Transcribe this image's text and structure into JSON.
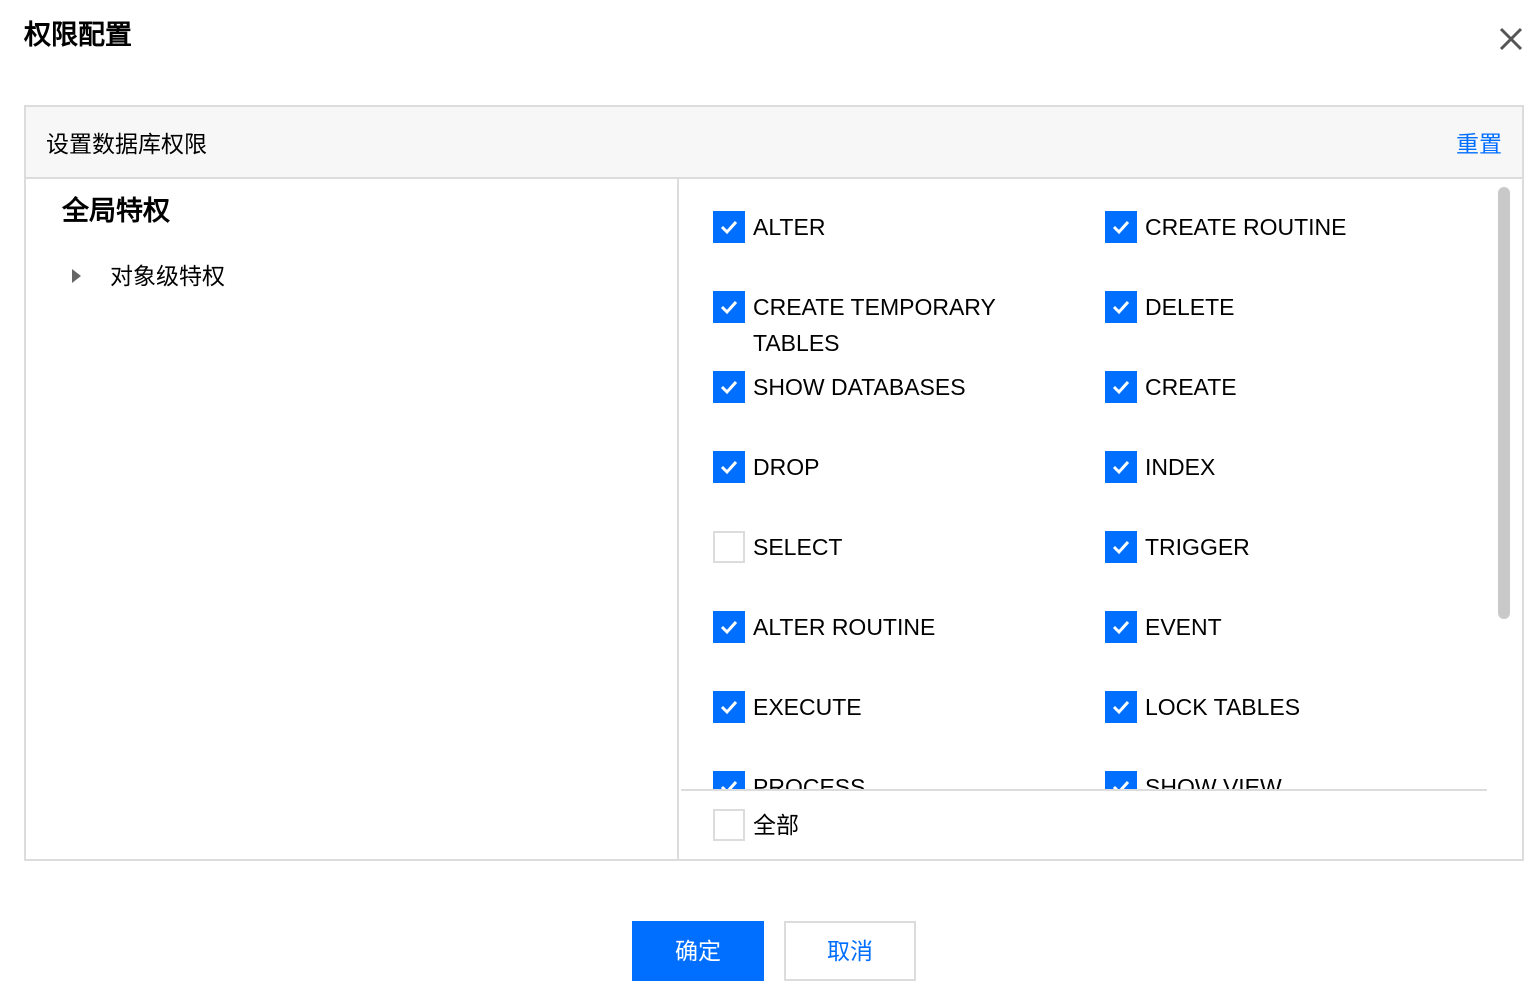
{
  "dialog": {
    "title": "权限配置",
    "close_icon": "close-icon"
  },
  "panel": {
    "title": "设置数据库权限",
    "reset_label": "重置"
  },
  "tree": {
    "root_label": "全局特权",
    "node_label": "对象级特权",
    "node_icon": "caret-right-icon"
  },
  "permissions": [
    {
      "label": "ALTER",
      "checked": true
    },
    {
      "label": "CREATE ROUTINE",
      "checked": true
    },
    {
      "label": "CREATE TEMPORARY TABLES",
      "checked": true
    },
    {
      "label": "DELETE",
      "checked": true
    },
    {
      "label": "SHOW DATABASES",
      "checked": true
    },
    {
      "label": "CREATE",
      "checked": true
    },
    {
      "label": "DROP",
      "checked": true
    },
    {
      "label": "INDEX",
      "checked": true
    },
    {
      "label": "SELECT",
      "checked": false
    },
    {
      "label": "TRIGGER",
      "checked": true
    },
    {
      "label": "ALTER ROUTINE",
      "checked": true
    },
    {
      "label": "EVENT",
      "checked": true
    },
    {
      "label": "EXECUTE",
      "checked": true
    },
    {
      "label": "LOCK TABLES",
      "checked": true
    },
    {
      "label": "PROCESS",
      "checked": true
    },
    {
      "label": "SHOW VIEW",
      "checked": true
    }
  ],
  "select_all": {
    "label": "全部",
    "checked": false
  },
  "footer": {
    "ok_label": "确定",
    "cancel_label": "取消"
  },
  "colors": {
    "accent": "#006eff",
    "border": "#dcdcdc",
    "header_bg": "#f7f7f7"
  }
}
